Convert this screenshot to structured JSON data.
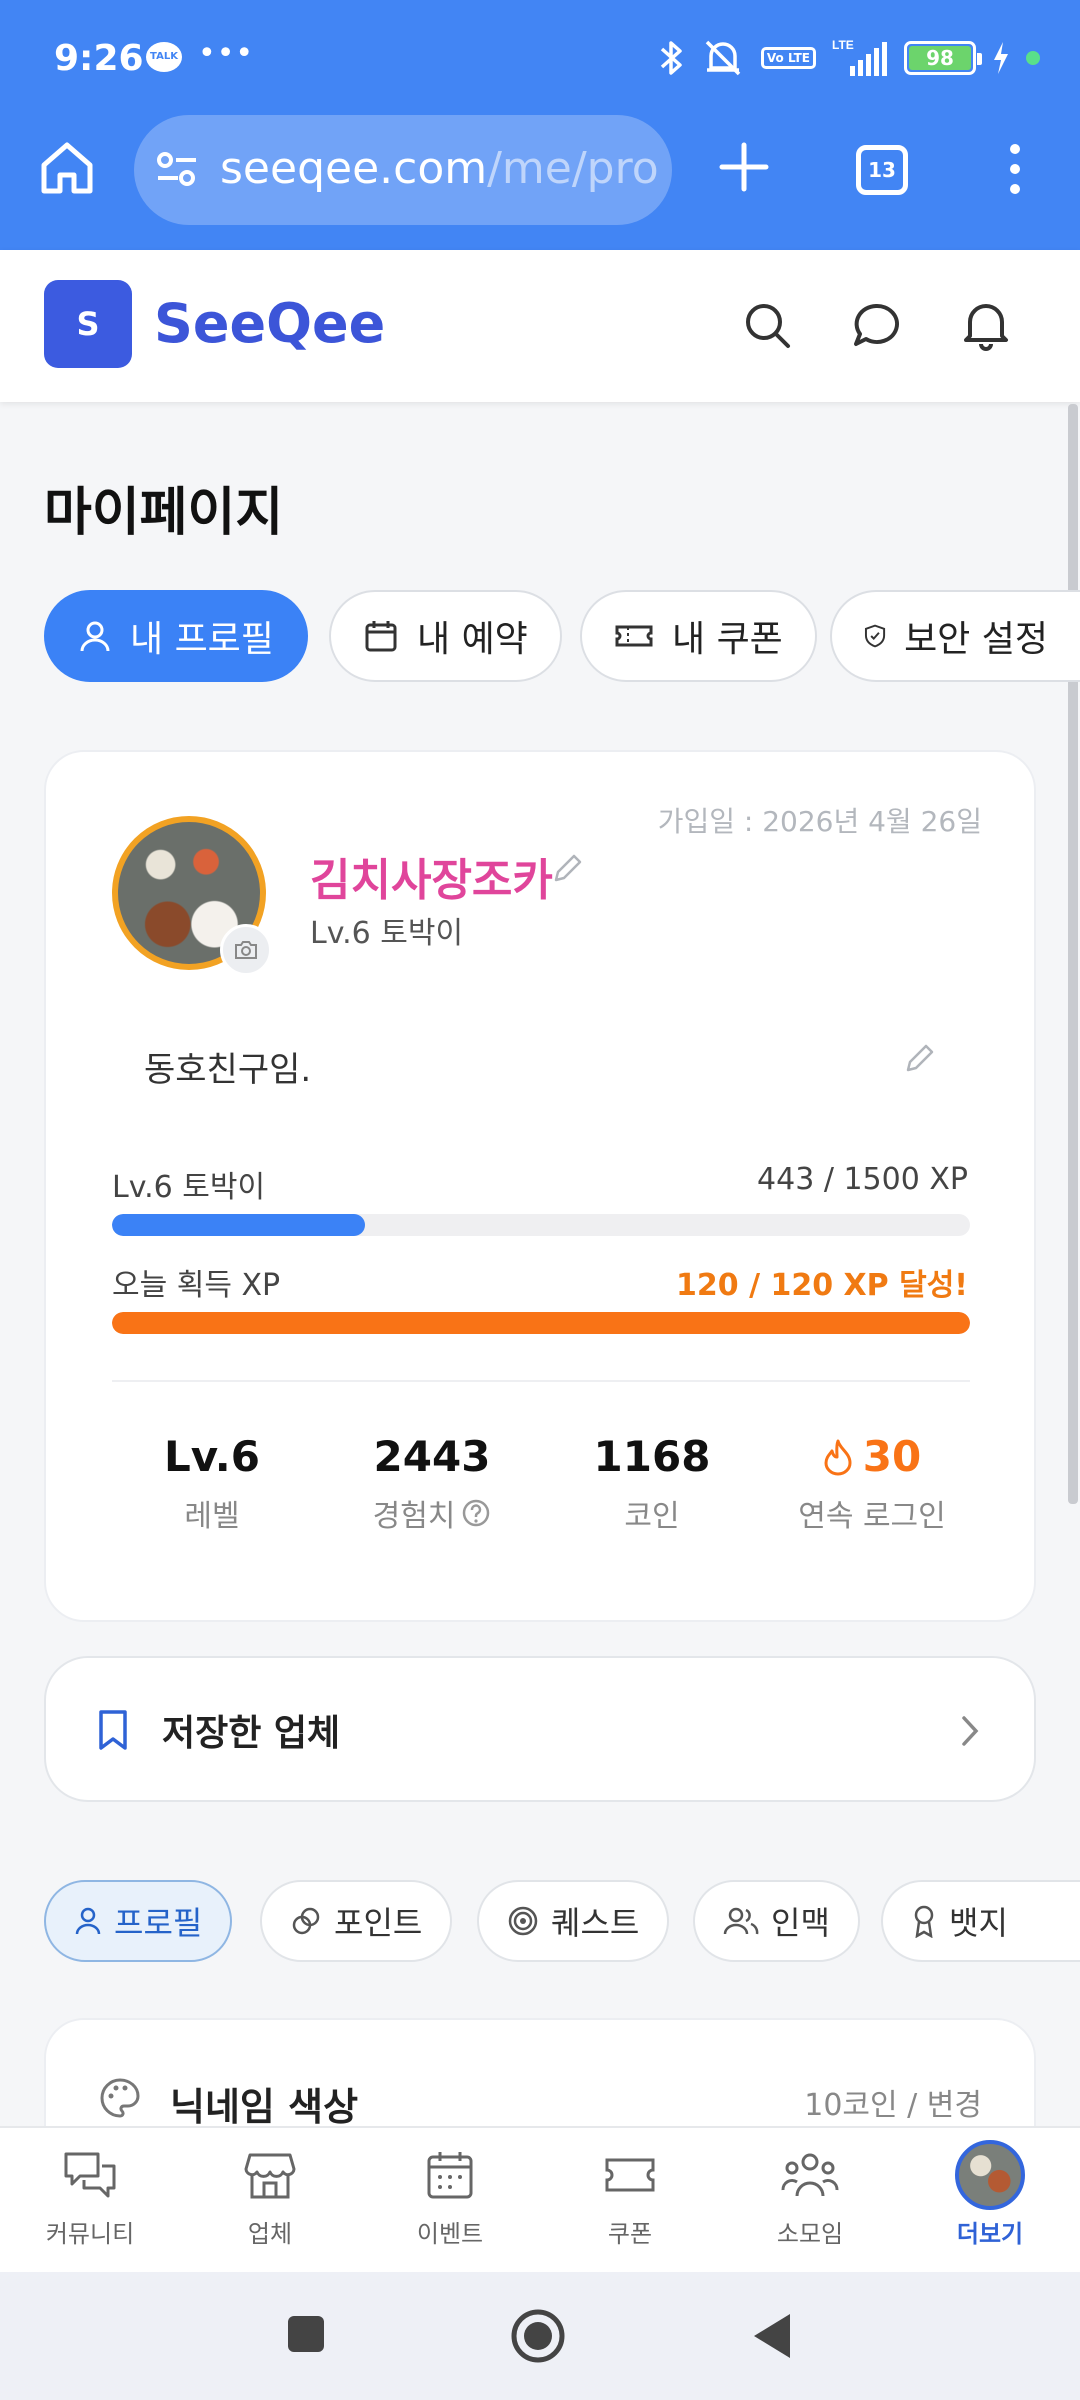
{
  "status_bar": {
    "time": "9:26",
    "talk_badge": "TALK",
    "more": "•••",
    "volte": "Vo LTE",
    "network": "LTE",
    "battery": "98"
  },
  "browser": {
    "url_host": "seeqee.com",
    "url_path": "/me/pro",
    "tab_count": "13"
  },
  "header": {
    "logo_letter": "S",
    "brand": "SeeQee"
  },
  "page": {
    "title": "마이페이지",
    "tabs": [
      {
        "label": "내 프로필",
        "icon": "user-icon",
        "active": true
      },
      {
        "label": "내 예약",
        "icon": "calendar-icon"
      },
      {
        "label": "내 쿠폰",
        "icon": "ticket-icon"
      },
      {
        "label": "보안 설정",
        "icon": "shield-icon"
      }
    ]
  },
  "profile": {
    "joined": "가입일 : 2026년 4월 26일",
    "nickname": "김치사장조카",
    "level_title": "Lv.6 토박이",
    "bio": "동호친구임.",
    "level_bar": {
      "label": "Lv.6 토박이",
      "value": "443 / 1500 XP",
      "progress": 0.295
    },
    "today_bar": {
      "label": "오늘 획득 XP",
      "value": "120 / 120 XP 달성!",
      "progress": 1.0
    },
    "stats": [
      {
        "num": "Lv.6",
        "label": "레벨"
      },
      {
        "num": "2443",
        "label": "경험치"
      },
      {
        "num": "1168",
        "label": "코인"
      },
      {
        "num": "30",
        "label": "연속 로그인"
      }
    ]
  },
  "saved": {
    "label": "저장한 업체"
  },
  "subtabs": [
    {
      "label": "프로필",
      "icon": "user-icon",
      "active": true
    },
    {
      "label": "포인트",
      "icon": "coin-icon"
    },
    {
      "label": "퀘스트",
      "icon": "target-icon"
    },
    {
      "label": "인맥",
      "icon": "people-icon"
    },
    {
      "label": "뱃지",
      "icon": "badge-icon"
    }
  ],
  "nickname_color": {
    "title": "닉네임 색상",
    "right": "10코인 / 변경"
  },
  "bottom_nav": [
    {
      "label": "커뮤니티",
      "icon": "chat-icon"
    },
    {
      "label": "업체",
      "icon": "store-icon"
    },
    {
      "label": "이벤트",
      "icon": "calendar-icon"
    },
    {
      "label": "쿠폰",
      "icon": "ticket-icon"
    },
    {
      "label": "소모임",
      "icon": "group-icon"
    },
    {
      "label": "더보기",
      "icon": "avatar-icon",
      "active": true
    }
  ],
  "colors": {
    "chrome": "#4285f4",
    "brand": "#3c55d8",
    "nickname": "#e0459b",
    "xp_bar": "#3b82f6",
    "today_bar": "#f97316",
    "today_text": "#f07a12",
    "streak": "#f97316"
  }
}
